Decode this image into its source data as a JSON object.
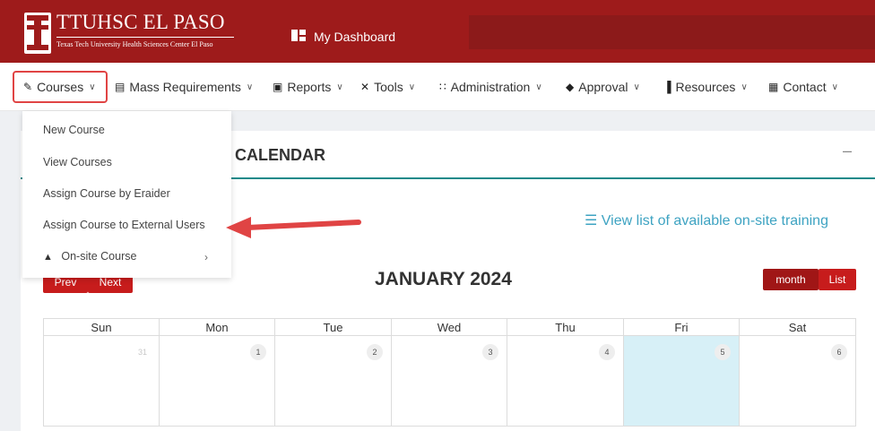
{
  "header": {
    "logo_title": "TTUHSC EL PASO",
    "logo_subtitle": "Texas Tech University Health Sciences Center El Paso",
    "dashboard_label": "My Dashboard",
    "color": "#9e1b1b"
  },
  "nav": {
    "items": [
      {
        "label": "Courses",
        "icon": "pen-icon"
      },
      {
        "label": "Mass Requirements",
        "icon": "book-icon"
      },
      {
        "label": "Reports",
        "icon": "report-icon"
      },
      {
        "label": "Tools",
        "icon": "tools-icon"
      },
      {
        "label": "Administration",
        "icon": "users-icon"
      },
      {
        "label": "Approval",
        "icon": "handshake-icon"
      },
      {
        "label": "Resources",
        "icon": "library-icon"
      },
      {
        "label": "Contact",
        "icon": "contact-icon"
      }
    ]
  },
  "dropdown": {
    "items": [
      {
        "label": "New Course"
      },
      {
        "label": "View Courses"
      },
      {
        "label": "Assign Course by Eraider"
      },
      {
        "label": "Assign Course to External Users"
      },
      {
        "label": "On-site Course",
        "icon": "building-icon"
      }
    ]
  },
  "card": {
    "title": "CALENDAR",
    "minimize": "–",
    "view_list": "View list of available on-site training"
  },
  "calendar": {
    "title": "JANUARY 2024",
    "prev": "Prev",
    "next": "Next",
    "month": "month",
    "list": "List",
    "weekdays": [
      "Sun",
      "Mon",
      "Tue",
      "Wed",
      "Thu",
      "Fri",
      "Sat"
    ],
    "days": [
      "31",
      "1",
      "2",
      "3",
      "4",
      "5",
      "6"
    ]
  }
}
